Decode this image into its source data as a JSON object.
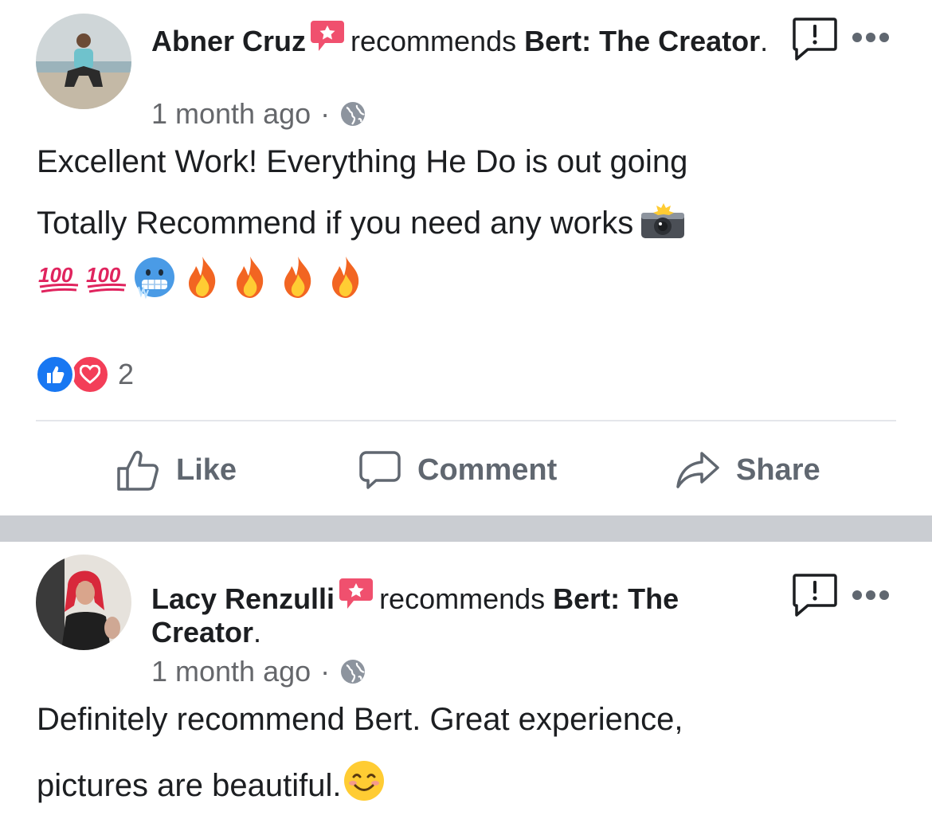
{
  "posts": [
    {
      "author": "Abner Cruz",
      "verb": "recommends",
      "page": "Bert: The Creator",
      "period": ".",
      "time": "1 month ago",
      "separator": "·",
      "lines": [
        "Excellent Work! Everything He Do is out going",
        "Totally Recommend if you need any works"
      ],
      "line2_emoji": "camera-flash-emoji",
      "emoji_row": [
        "hundred-points-emoji",
        "hundred-points-emoji",
        "cold-face-emoji",
        "fire-emoji",
        "fire-emoji",
        "fire-emoji",
        "fire-emoji"
      ],
      "reactions": {
        "icons": [
          "like",
          "love"
        ],
        "count": "2"
      },
      "actions": {
        "like": "Like",
        "comment": "Comment",
        "share": "Share"
      }
    },
    {
      "author": "Lacy Renzulli",
      "verb": "recommends",
      "page": "Bert: The Creator",
      "period": ".",
      "time": "1 month ago",
      "separator": "·",
      "lines": [
        "Definitely recommend Bert. Great experience,",
        "pictures are beautiful."
      ],
      "line2_emoji": "smiling-face-emoji"
    }
  ],
  "colors": {
    "text": "#1c1e21",
    "muted": "#65676b",
    "recommend_badge": "#f0506e",
    "like_blue": "#1877f2",
    "love_red": "#f33e58",
    "divider_band": "#cacdd2"
  }
}
